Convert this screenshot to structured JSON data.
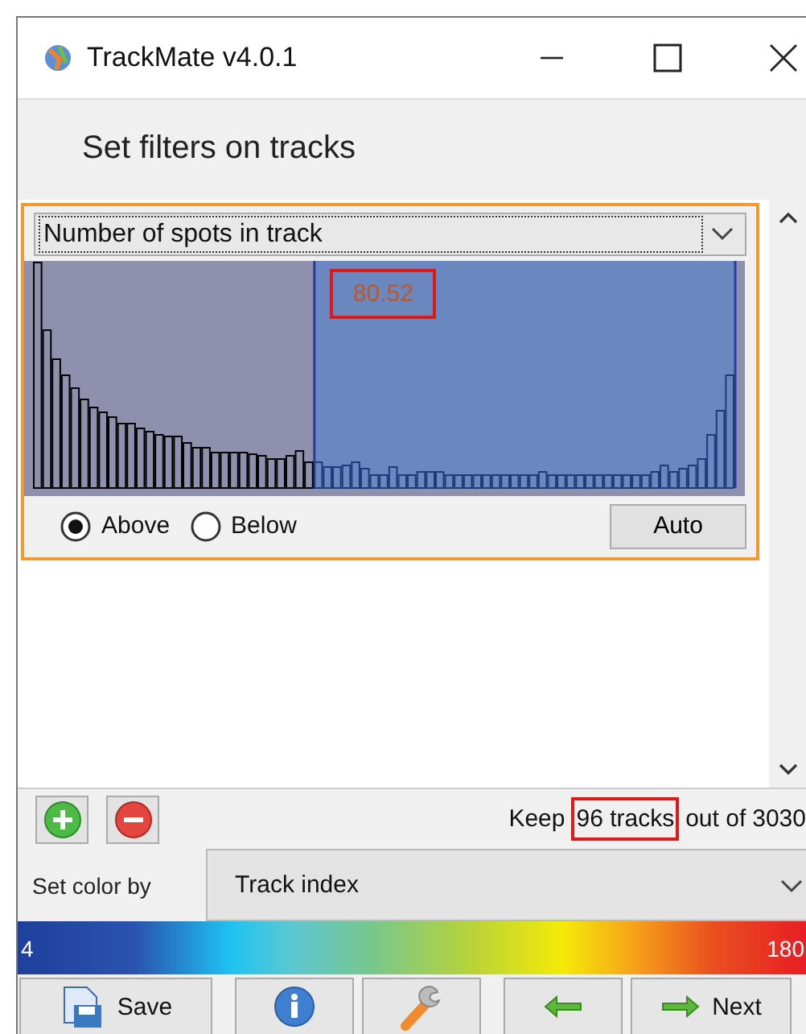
{
  "window": {
    "title": "TrackMate v4.0.1"
  },
  "header": "Set filters on tracks",
  "filter": {
    "feature": "Number of spots in track",
    "threshold": {
      "value": "80.52"
    },
    "radios": [
      {
        "label": "Above",
        "selected": true
      },
      {
        "label": "Below",
        "selected": false
      }
    ],
    "auto_button": "Auto"
  },
  "summary": {
    "prefix": "Keep",
    "count": "96 tracks",
    "middle": "out of",
    "total": "3030"
  },
  "color_by": {
    "label": "Set color by",
    "value": "Track index",
    "min": "4",
    "max": "180"
  },
  "buttons": [
    {
      "kind": "save",
      "label": "Save"
    },
    {
      "kind": "info"
    },
    {
      "kind": "settings"
    },
    {
      "kind": "back"
    },
    {
      "kind": "next",
      "label": "Next"
    }
  ]
}
